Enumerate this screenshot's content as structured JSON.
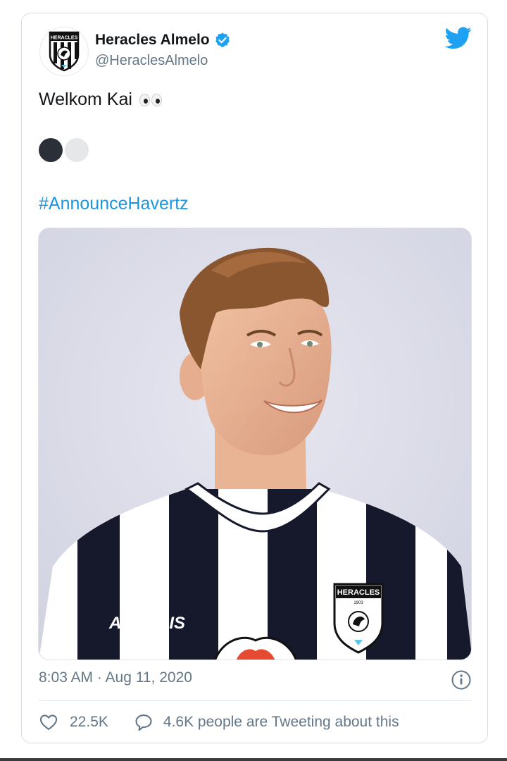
{
  "account": {
    "name": "Heracles Almelo",
    "handle": "@HeraclesAlmelo",
    "avatar_logo_text": "HERACLES",
    "verified": true
  },
  "tweet": {
    "line1": "Welkom Kai",
    "emoji": "eyes-emoji",
    "circles": [
      "black-circle",
      "white-circle"
    ],
    "hashtag": "#AnnounceHavertz"
  },
  "media": {
    "shirt_sponsor": "ACERBIS",
    "crest_text": "HERACLES",
    "crest_year": "1903"
  },
  "meta": {
    "timestamp": "8:03 AM · Aug 11, 2020"
  },
  "stats": {
    "likes": "22.5K",
    "tweeting": "4.6K people are Tweeting about this"
  },
  "colors": {
    "link": "#1b95e0",
    "verified": "#1da1f2",
    "twitter_bird": "#1da1f2",
    "secondary_text": "#657786"
  },
  "icons": [
    "verified-badge-icon",
    "twitter-bird-icon",
    "info-icon",
    "heart-icon",
    "speech-bubble-icon"
  ]
}
